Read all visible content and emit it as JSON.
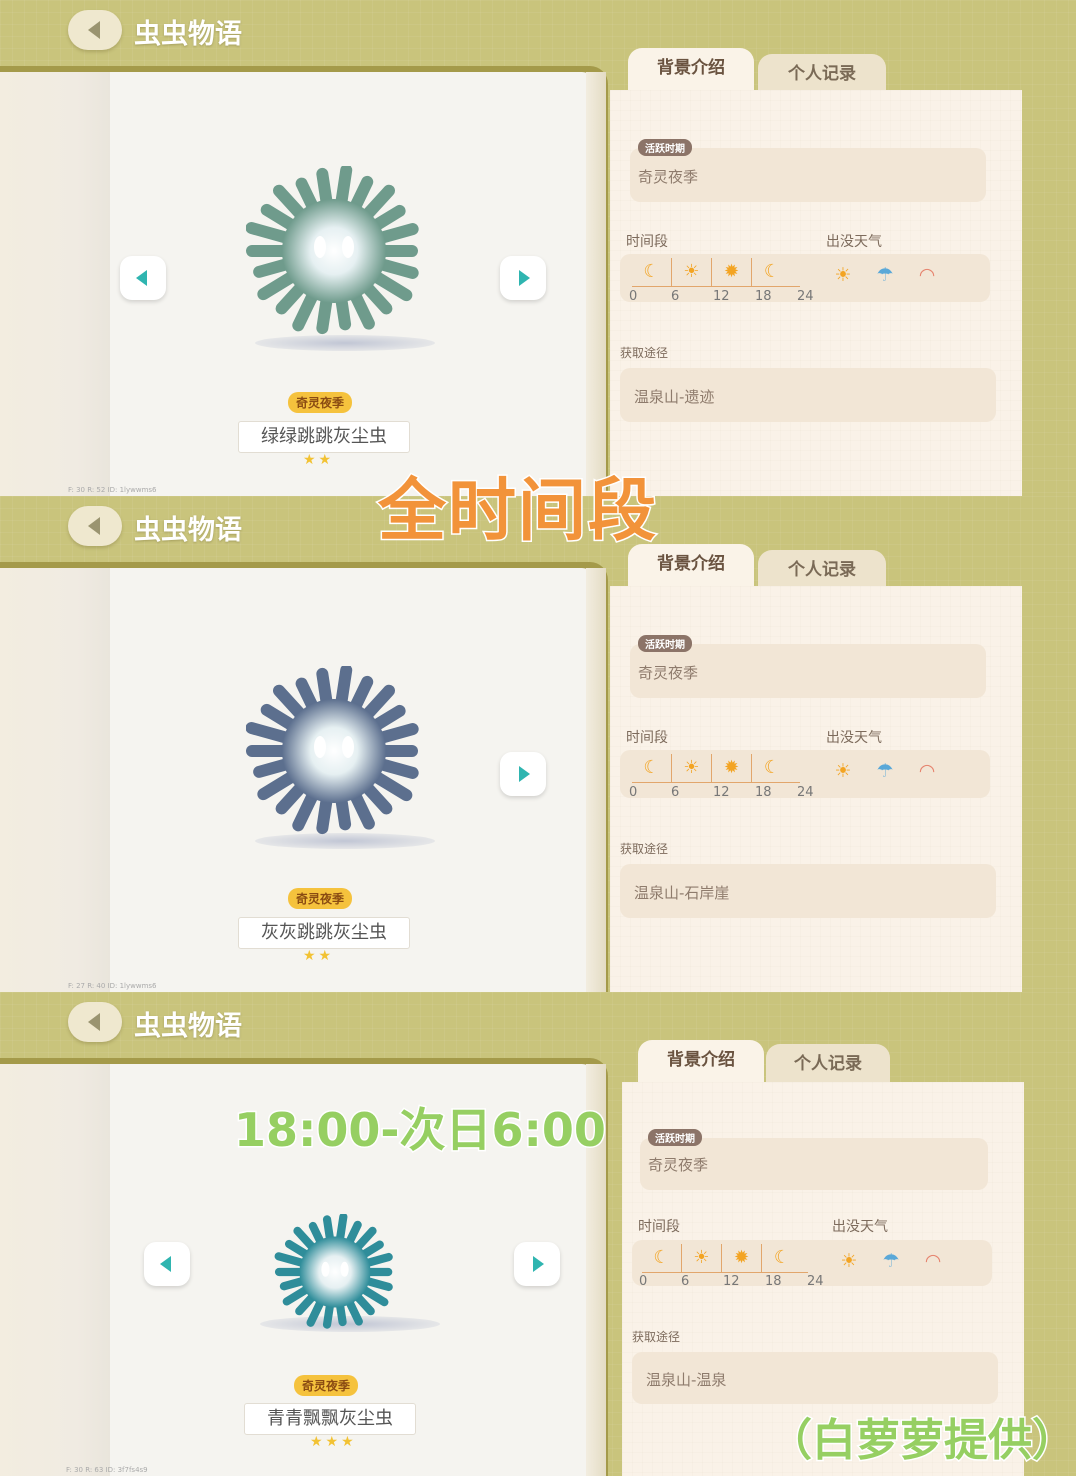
{
  "app_title": "虫虫物语",
  "tabs": {
    "intro": "背景介绍",
    "records": "个人记录"
  },
  "labels": {
    "active_period": "活跃时期",
    "time_period": "时间段",
    "weather": "出没天气",
    "obtain_route": "获取途径"
  },
  "time_ticks": [
    "0",
    "6",
    "12",
    "18",
    "24"
  ],
  "time_icons": [
    "moon-icon",
    "sunrise-icon",
    "sun-icon",
    "moon-icon"
  ],
  "weather_icons": [
    "sun-icon",
    "rain-cloud-icon",
    "rainbow-icon"
  ],
  "panels": [
    {
      "season": "奇灵夜季",
      "bug_name": "绿绿跳跳灰尘虫",
      "stars": 2,
      "active_period_value": "奇灵夜季",
      "route": "温泉山-遗迹",
      "bug_color": "#6f9b8c",
      "meta": "F: 30   R: 52   ID: 1lywwms6"
    },
    {
      "season": "奇灵夜季",
      "bug_name": "灰灰跳跳灰尘虫",
      "stars": 2,
      "active_period_value": "奇灵夜季",
      "route": "温泉山-石岸崖",
      "bug_color": "#5c6f8e",
      "meta": "F: 27   R: 40   ID: 1lywwms6"
    },
    {
      "season": "奇灵夜季",
      "bug_name": "青青飘飘灰尘虫",
      "stars": 3,
      "active_period_value": "奇灵夜季",
      "route": "温泉山-温泉",
      "bug_color": "#2f8d9a",
      "meta": "F: 30   R: 63   ID: 3f7fs4s9"
    }
  ],
  "overlay": {
    "all_time": "全时间段",
    "night_hours": "18:00-次日6:00",
    "credit": "（白萝萝提供）"
  },
  "colors": {
    "background": "#c9c47c",
    "accent_teal": "#2fb5b0",
    "season_tag": "#f5c23d",
    "overlay_orange": "#f2933a",
    "overlay_green": "#96cf62"
  }
}
